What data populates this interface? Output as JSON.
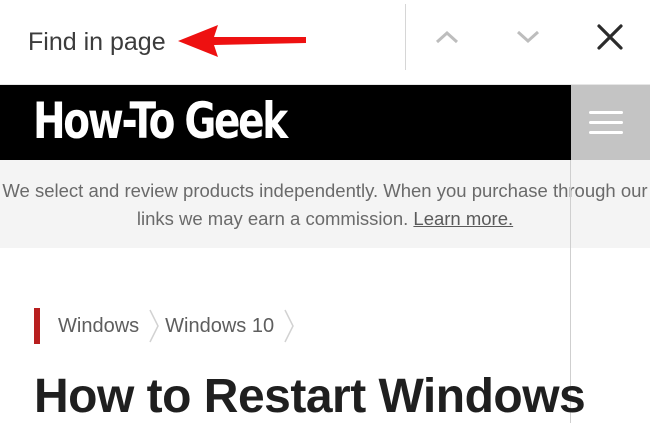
{
  "find_bar": {
    "placeholder": "Find in page",
    "prev_icon": "chevron-up-icon",
    "next_icon": "chevron-down-icon",
    "close_icon": "close-icon",
    "annotation_arrow_color": "#ee1111"
  },
  "site": {
    "logo_text": "How-To Geek",
    "menu_icon": "hamburger-menu-icon",
    "header_color": "#000000"
  },
  "disclosure": {
    "line1": "We select and review products independently. When you purchase through our",
    "line2": "links we may earn a commission.",
    "learn_more": "Learn more."
  },
  "breadcrumb": {
    "items": [
      "Windows",
      "Windows 10"
    ],
    "accent_color": "#b81f1f"
  },
  "article": {
    "title": "How to Restart Windows"
  }
}
